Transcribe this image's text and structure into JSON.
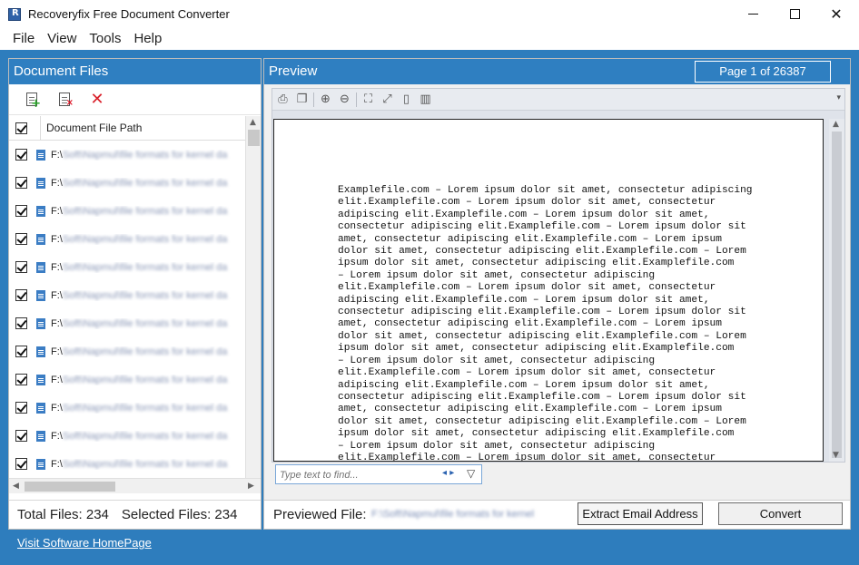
{
  "window": {
    "title": "Recoveryfix Free Document Converter",
    "minimize_glyph": "",
    "close_glyph": "✕"
  },
  "menu": [
    "File",
    "View",
    "Tools",
    "Help"
  ],
  "left_panel": {
    "title": "Document Files",
    "toolbar": {
      "add_icon": "add-document-icon",
      "remove_icon": "remove-document-icon",
      "clear_icon": "clear-all-icon",
      "clear_glyph": "✕"
    },
    "column_header": "Document File Path",
    "path_prefix": "F:\\",
    "blurred_path": "Soft\\Napmul\\file formats for kernel da",
    "rows": [
      {
        "checked": true
      },
      {
        "checked": true
      },
      {
        "checked": true
      },
      {
        "checked": true
      },
      {
        "checked": true
      },
      {
        "checked": true
      },
      {
        "checked": true
      },
      {
        "checked": true
      },
      {
        "checked": true
      },
      {
        "checked": true
      },
      {
        "checked": true
      },
      {
        "checked": true
      }
    ],
    "total_files": "Total Files: 234",
    "selected_files": "Selected Files: 234"
  },
  "right_panel": {
    "title": "Preview",
    "page_indicator": "Page 1 of 26387",
    "find_placeholder": "Type text to find...",
    "find_nav": "◂ ▸",
    "find_filter": "▽",
    "preview_text": "Examplefile.com – Lorem ipsum dolor sit amet, consectetur adipiscing\nelit.Examplefile.com – Lorem ipsum dolor sit amet, consectetur\nadipiscing elit.Examplefile.com – Lorem ipsum dolor sit amet,\nconsectetur adipiscing elit.Examplefile.com – Lorem ipsum dolor sit\namet, consectetur adipiscing elit.Examplefile.com – Lorem ipsum\ndolor sit amet, consectetur adipiscing elit.Examplefile.com – Lorem\nipsum dolor sit amet, consectetur adipiscing elit.Examplefile.com\n– Lorem ipsum dolor sit amet, consectetur adipiscing\nelit.Examplefile.com – Lorem ipsum dolor sit amet, consectetur\nadipiscing elit.Examplefile.com – Lorem ipsum dolor sit amet,\nconsectetur adipiscing elit.Examplefile.com – Lorem ipsum dolor sit\namet, consectetur adipiscing elit.Examplefile.com – Lorem ipsum\ndolor sit amet, consectetur adipiscing elit.Examplefile.com – Lorem\nipsum dolor sit amet, consectetur adipiscing elit.Examplefile.com\n– Lorem ipsum dolor sit amet, consectetur adipiscing\nelit.Examplefile.com – Lorem ipsum dolor sit amet, consectetur\nadipiscing elit.Examplefile.com – Lorem ipsum dolor sit amet,\nconsectetur adipiscing elit.Examplefile.com – Lorem ipsum dolor sit\namet, consectetur adipiscing elit.Examplefile.com – Lorem ipsum\ndolor sit amet, consectetur adipiscing elit.Examplefile.com – Lorem\nipsum dolor sit amet, consectetur adipiscing elit.Examplefile.com\n– Lorem ipsum dolor sit amet, consectetur adipiscing\nelit.Examplefile.com – Lorem ipsum dolor sit amet, consectetur",
    "previewed_file_label": "Previewed File:",
    "previewed_file_value": "F:\\Soft\\Napmul\\file formats for kernel",
    "extract_button": "Extract Email Address",
    "convert_button": "Convert"
  },
  "footer": {
    "homepage_link": "Visit Software HomePage"
  },
  "colors": {
    "frame_blue": "#2e7dbd",
    "header_blue": "#2f7fc1"
  }
}
